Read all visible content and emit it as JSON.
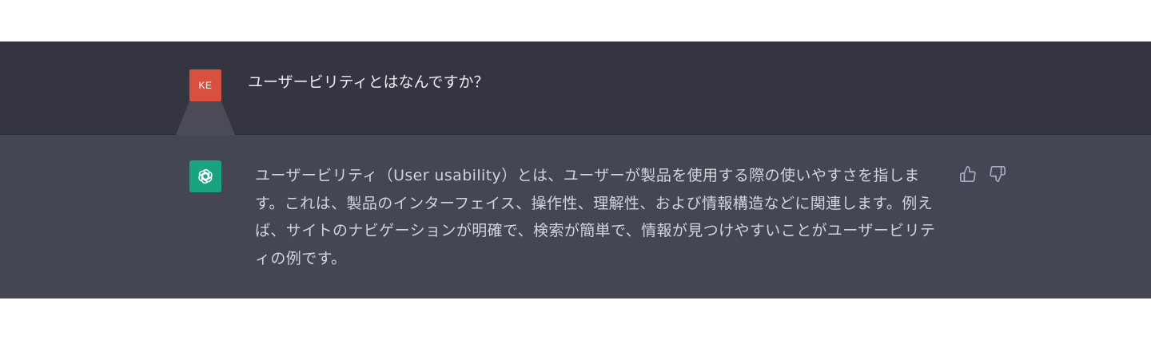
{
  "user_message": {
    "avatar_initials": "KE",
    "text": "ユーザービリティとはなんですか？"
  },
  "assistant_message": {
    "avatar_icon": "openai-logo-icon",
    "text": "ユーザービリティ（User usability）とは、ユーザーが製品を使用する際の使いやすさを指します。これは、製品のインターフェイス、操作性、理解性、および情報構造などに関連します。例えば、サイトのナビゲーションが明確で、検索が簡単で、情報が見つけやすいことがユーザービリティの例です。"
  },
  "feedback": {
    "thumbs_up_icon": "thumbs-up-icon",
    "thumbs_down_icon": "thumbs-down-icon"
  },
  "colors": {
    "user_row_bg": "#343541",
    "assistant_row_bg": "#444654",
    "user_avatar_bg": "#d9503f",
    "assistant_avatar_bg": "#19a37f",
    "text": "#d1d5db"
  }
}
